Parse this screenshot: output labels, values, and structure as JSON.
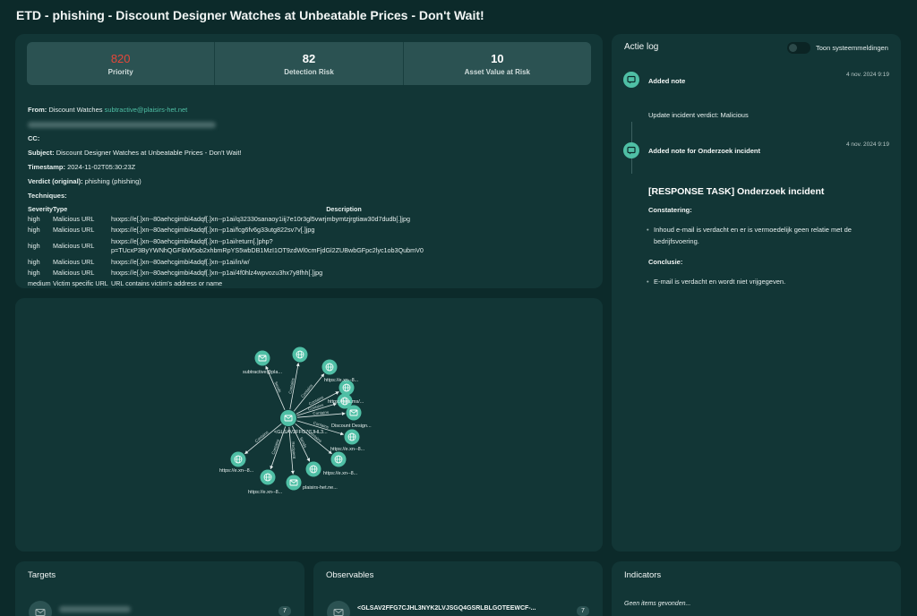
{
  "page_title": "ETD - phishing - Discount Designer Watches at Unbeatable Prices - Don't Wait!",
  "stats": [
    {
      "value": "820",
      "label": "Priority",
      "color": "#e5473a"
    },
    {
      "value": "82",
      "label": "Detection Risk"
    },
    {
      "value": "10",
      "label": "Asset Value at Risk"
    }
  ],
  "email": {
    "from_label": "From:",
    "from_name": "Discount Watches",
    "from_address": "subtractive@plaisirs-het.net",
    "cc_label": "CC:",
    "subject_label": "Subject:",
    "subject": "Discount Designer Watches at Unbeatable Prices - Don't Wait!",
    "timestamp_label": "Timestamp:",
    "timestamp": "2024-11-02T05:30:23Z",
    "verdict_label": "Verdict (original):",
    "verdict": "phishing (phishing)",
    "techniques_label": "Techniques:",
    "columns": {
      "severity": "Severity",
      "type": "Type",
      "description": "Description"
    },
    "rows": [
      {
        "severity": "high",
        "type": "Malicious URL",
        "description": "hxxps://e[.]xn--80aehcgimbi4adqf[.]xn--p1ai/q32330sanaoy1iij7e10r3gl5vwrjmbymtzjrgtiaw30d7dudb[.]jpg"
      },
      {
        "severity": "high",
        "type": "Malicious URL",
        "description": "hxxps://e[.]xn--80aehcgimbi4adqf[.]xn--p1ai/fcg6fv6g33utg822sv7v[.]jpg"
      },
      {
        "severity": "high",
        "type": "Malicious URL",
        "description": "hxxps://e[.]xn--80aehcgimbi4adqf[.]xn--p1ai/return[.]php?",
        "description2": "p=TUcxP3ByYWNhQGFibW5ob2xhbmRpYS5wbDB1MzI1OT9zdWl0cmFjdGl2ZUBwbGFpc2lyc1ob3QubmV0"
      },
      {
        "severity": "high",
        "type": "Malicious URL",
        "description": "hxxps://e[.]xn--80aehcgimbi4adqf[.]xn--p1ai/in/w/"
      },
      {
        "severity": "high",
        "type": "Malicious URL",
        "description": "hxxps://e[.]xn--80aehcgimbi4adqf[.]xn--p1ai/4f0hlz4wpvozu3hx7y8fhh[.]jpg"
      },
      {
        "severity": "medium",
        "type": "Victim specific URL",
        "description": "URL contains victim's address or name"
      }
    ]
  },
  "graph": {
    "center_label": "<GLSAV2FFG7CJHL3...",
    "nodes": [
      {
        "label": "subtractive@pla...",
        "icon": "mail-icon"
      },
      {
        "label": "",
        "icon": "globe-icon"
      },
      {
        "label": "",
        "icon": "globe-icon"
      },
      {
        "label": "https://e.xn--8...",
        "icon": "globe-icon"
      },
      {
        "label": "https://aka.ms/...",
        "icon": "globe-icon"
      },
      {
        "label": "Discount Design...",
        "icon": "mail-icon"
      },
      {
        "label": "https://e.xn--8...",
        "icon": "globe-icon"
      },
      {
        "label": "https://e.xn--8...",
        "icon": "globe-icon"
      },
      {
        "label": "plaisirs-het.ne...",
        "icon": "globe-icon"
      },
      {
        "label": "",
        "icon": "mail-icon"
      },
      {
        "label": "https://e.xn--8...",
        "icon": "globe-icon"
      },
      {
        "label": "https://e.xn--8...",
        "icon": "globe-icon"
      }
    ],
    "edge_labels": [
      "Sends",
      "Contains",
      "Contains",
      "Contains",
      "Contains",
      "Contains",
      "Contains",
      "Contains",
      "Sends",
      "Recipient",
      "Contains",
      "Contains"
    ]
  },
  "log": {
    "title": "Actie log",
    "toggle_label": "Toon systeemmeldingen",
    "entries": [
      {
        "title": "Added note",
        "time": "4 nov. 2024 9:19",
        "text": "Update incident verdict: Malicious"
      },
      {
        "title": "Added note for Onderzoek incident",
        "time": "4 nov. 2024 9:19"
      }
    ],
    "task": {
      "title": "[RESPONSE TASK] Onderzoek incident",
      "finding_label": "Constatering:",
      "finding_line1": "Inhoud e-mail is verdacht en er is vermoedelijk geen relatie met de",
      "finding_line2": "bedrijfsvoering.",
      "conclusion_label": "Conclusie:",
      "conclusion": "E-mail is verdacht en wordt niet vrijgegeven."
    }
  },
  "targets": {
    "title": "Targets",
    "count": "7"
  },
  "observables": {
    "title": "Observables",
    "item": "<GLSAV2FFG7CJHL3NYK2LVJSGQ4GSRLBLGOTEEWCF-...",
    "count": "7"
  },
  "indicators": {
    "title": "Indicators",
    "empty": "Geen items gevonden..."
  }
}
